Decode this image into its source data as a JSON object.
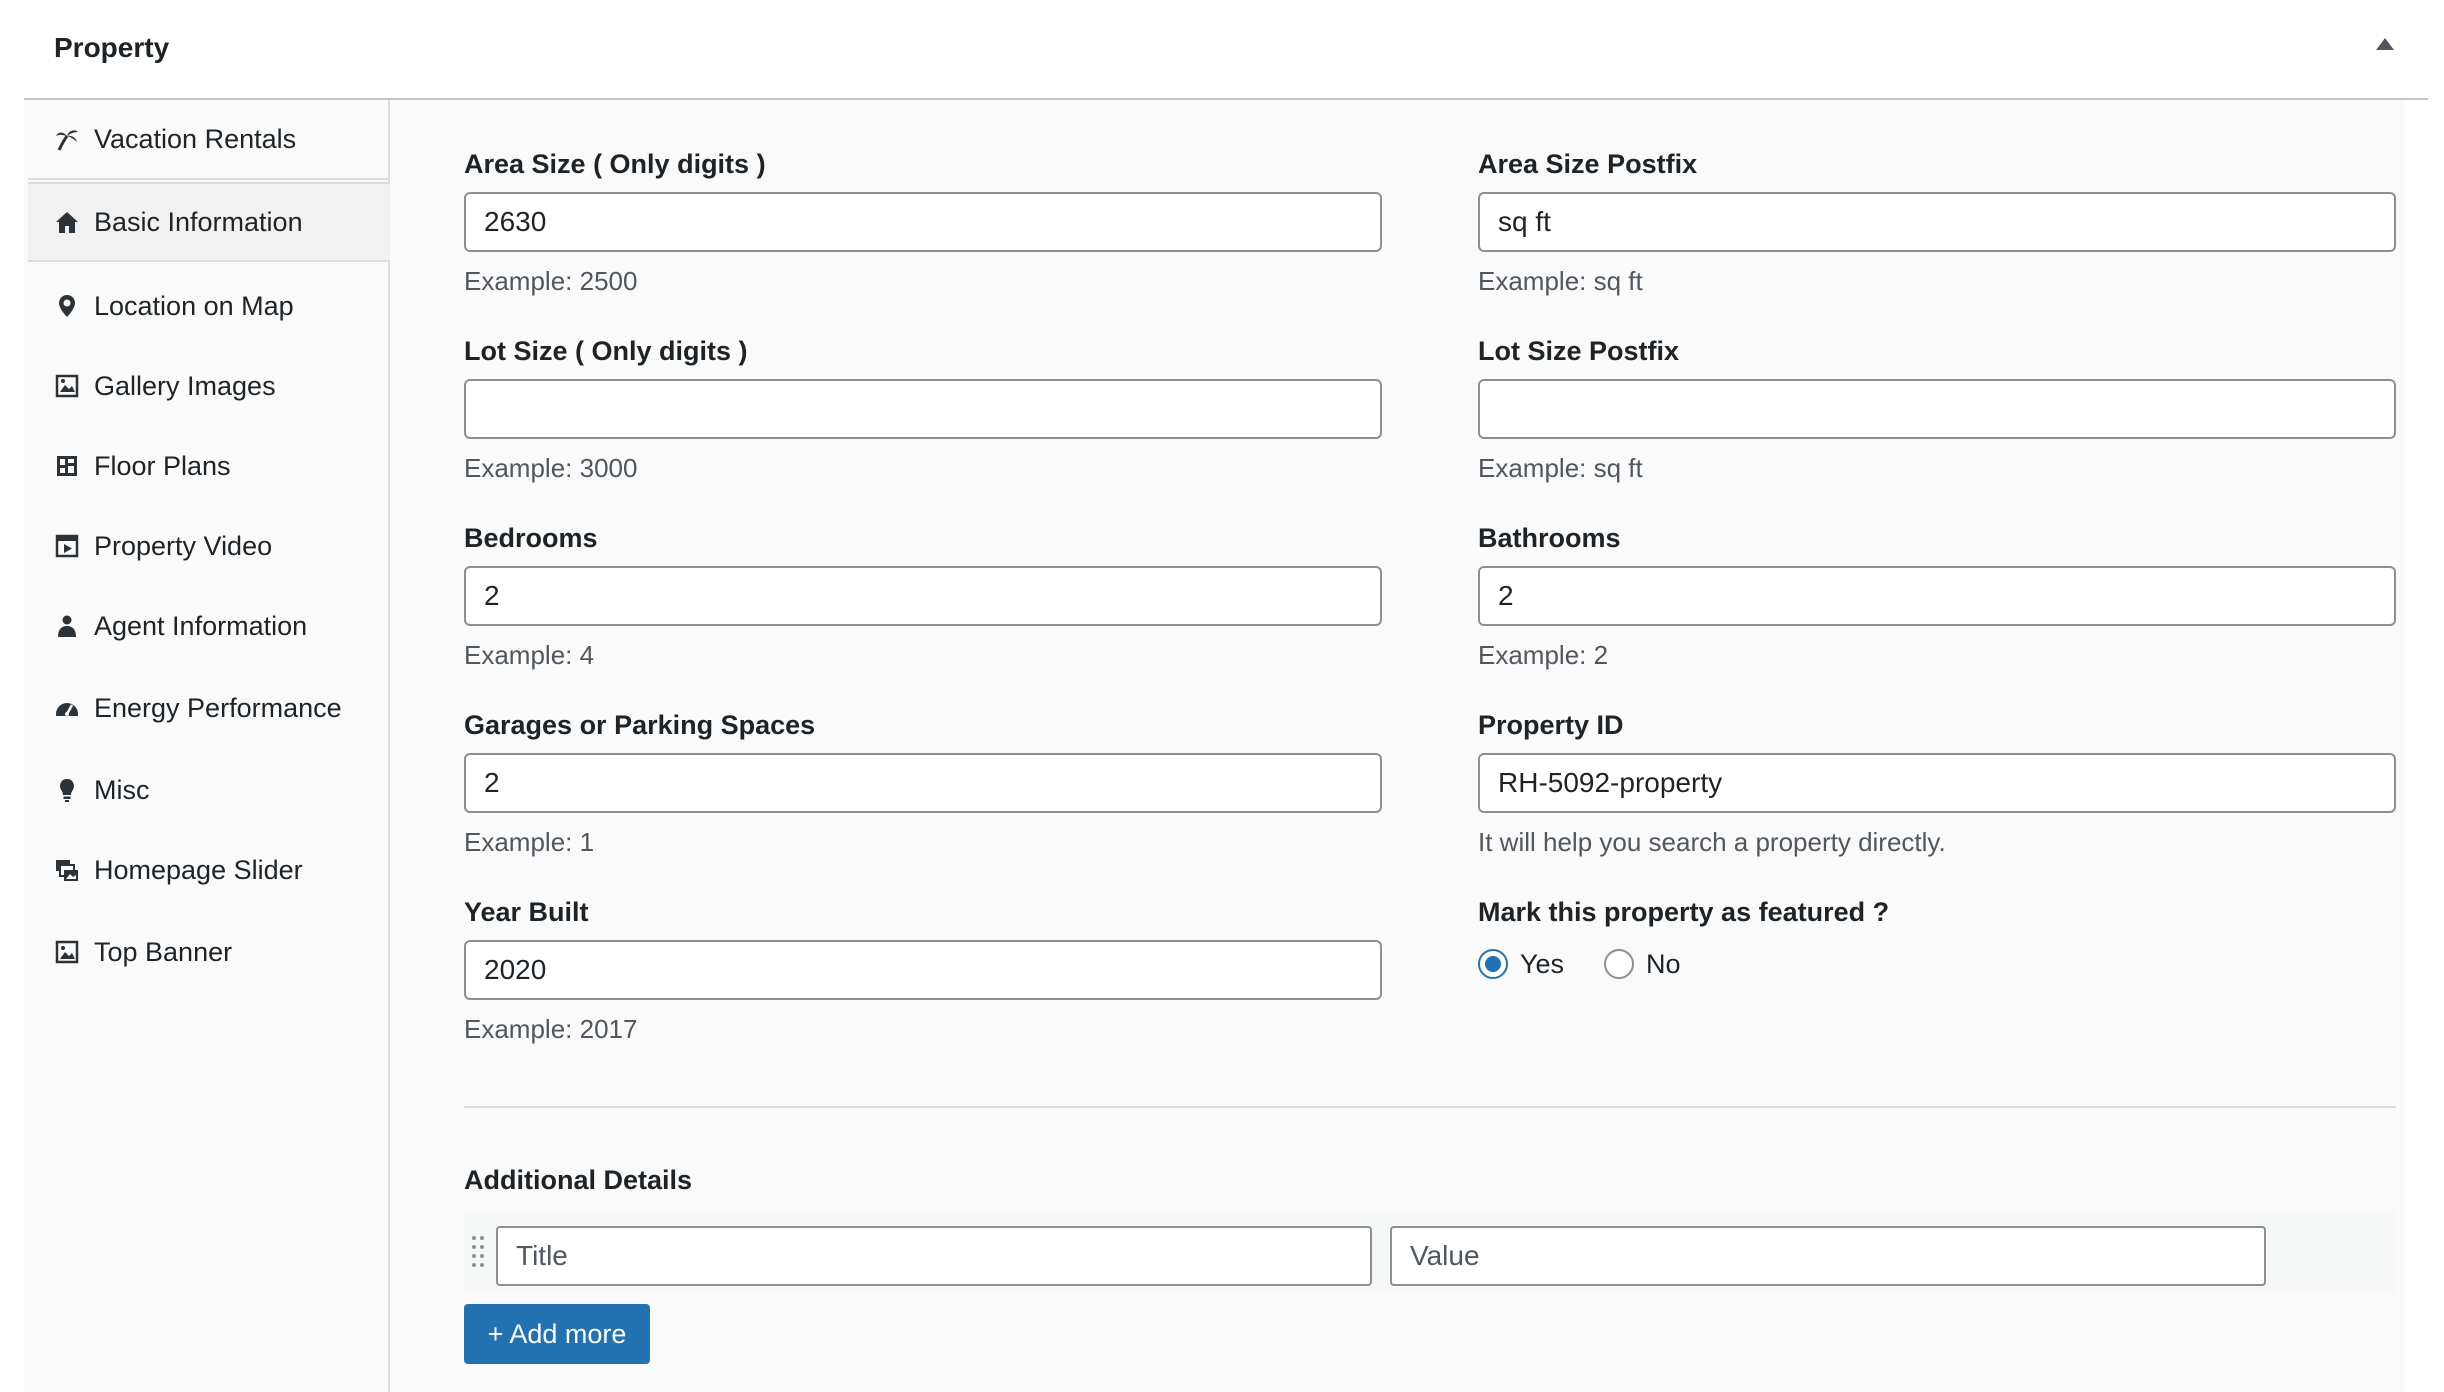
{
  "panel": {
    "title": "Property"
  },
  "sidebar": {
    "items": [
      {
        "label": "Vacation Rentals",
        "icon": "palm-tree-icon"
      },
      {
        "label": "Basic Information",
        "icon": "home-icon",
        "active": true
      },
      {
        "label": "Location on Map",
        "icon": "map-pin-icon"
      },
      {
        "label": "Gallery Images",
        "icon": "gallery-icon"
      },
      {
        "label": "Floor Plans",
        "icon": "floor-plan-icon"
      },
      {
        "label": "Property Video",
        "icon": "video-icon"
      },
      {
        "label": "Agent Information",
        "icon": "agent-icon"
      },
      {
        "label": "Energy Performance",
        "icon": "gauge-icon"
      },
      {
        "label": "Misc",
        "icon": "lightbulb-icon"
      },
      {
        "label": "Homepage Slider",
        "icon": "slider-icon"
      },
      {
        "label": "Top Banner",
        "icon": "image-icon"
      }
    ]
  },
  "fields": {
    "area_size": {
      "label": "Area Size ( Only digits )",
      "value": "2630",
      "help": "Example: 2500"
    },
    "area_postfix": {
      "label": "Area Size Postfix",
      "value": "sq ft",
      "help": "Example: sq ft"
    },
    "lot_size": {
      "label": "Lot Size ( Only digits )",
      "value": "",
      "help": "Example: 3000"
    },
    "lot_postfix": {
      "label": "Lot Size Postfix",
      "value": "",
      "help": "Example: sq ft"
    },
    "bedrooms": {
      "label": "Bedrooms",
      "value": "2",
      "help": "Example: 4"
    },
    "bathrooms": {
      "label": "Bathrooms",
      "value": "2",
      "help": "Example: 2"
    },
    "garages": {
      "label": "Garages or Parking Spaces",
      "value": "2",
      "help": "Example: 1"
    },
    "property_id": {
      "label": "Property ID",
      "value": "RH-5092-property",
      "help": "It will help you search a property directly."
    },
    "year_built": {
      "label": "Year Built",
      "value": "2020",
      "help": "Example: 2017"
    },
    "featured": {
      "label": "Mark this property as featured ?",
      "yes": "Yes",
      "no": "No",
      "selected": "Yes"
    }
  },
  "additional": {
    "title": "Additional Details",
    "title_placeholder": "Title",
    "value_placeholder": "Value",
    "add_label": "+ Add more"
  },
  "colors": {
    "accent": "#2271b1"
  }
}
